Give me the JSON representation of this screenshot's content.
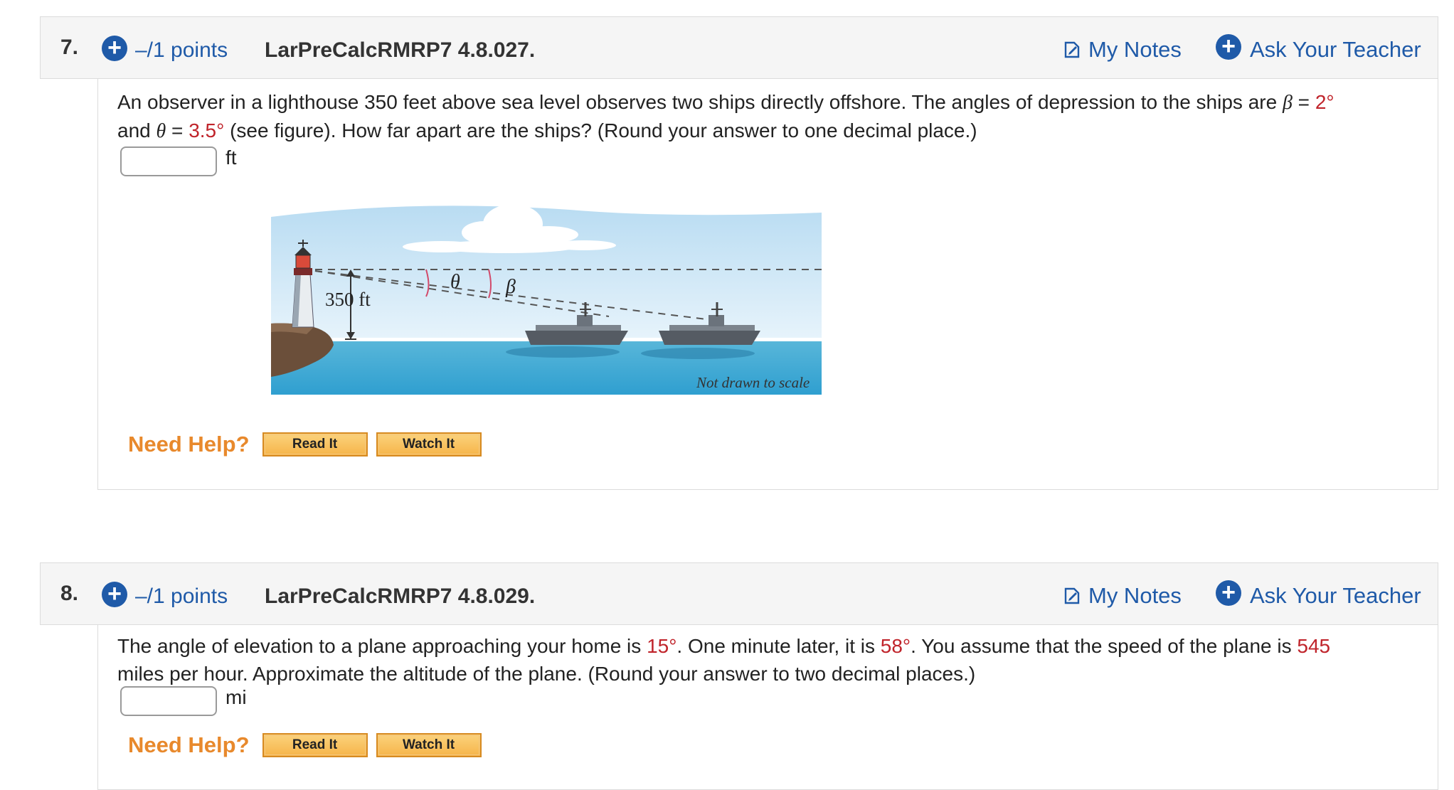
{
  "questions": [
    {
      "number": "7.",
      "points": "–/1 points",
      "assignment_id": "LarPreCalcRMRP7 4.8.027.",
      "my_notes": "My Notes",
      "ask_teacher": "Ask Your Teacher",
      "text_1": "An observer in a lighthouse 350 feet above sea level observes two ships directly offshore. The angles of depression to the ships are ",
      "beta_symbol": "β",
      "eq_1": " = ",
      "beta_value": "2°",
      "text_2": "and ",
      "theta_symbol": "θ",
      "eq_2": " = ",
      "theta_value": "3.5°",
      "text_3": " (see figure). How far apart are the ships? (Round your answer to one decimal place.)",
      "answer_value": "",
      "answer_unit": "ft",
      "figure": {
        "height_label": "350 ft",
        "theta_label": "θ",
        "beta_label": "β",
        "scale_note": "Not drawn to scale"
      },
      "need_help": "Need Help?",
      "read_it": "Read It",
      "watch_it": "Watch It"
    },
    {
      "number": "8.",
      "points": "–/1 points",
      "assignment_id": "LarPreCalcRMRP7 4.8.029.",
      "my_notes": "My Notes",
      "ask_teacher": "Ask Your Teacher",
      "text_1": "The angle of elevation to a plane approaching your home is ",
      "angle_1": "15°",
      "text_2": ". One minute later, it is ",
      "angle_2": "58°",
      "text_3": ". You assume that the speed of the plane is ",
      "speed": "545",
      "text_4": "miles per hour. Approximate the altitude of the plane. (Round your answer to two decimal places.)",
      "answer_value": "",
      "answer_unit": "mi",
      "need_help": "Need Help?",
      "read_it": "Read It",
      "watch_it": "Watch It"
    }
  ],
  "colors": {
    "link_blue": "#1f5aa8",
    "value_red": "#c0242b",
    "help_orange": "#e8892c",
    "button_fill": "#f6b54a"
  },
  "icons": [
    "plus-circle-icon",
    "note-icon"
  ]
}
